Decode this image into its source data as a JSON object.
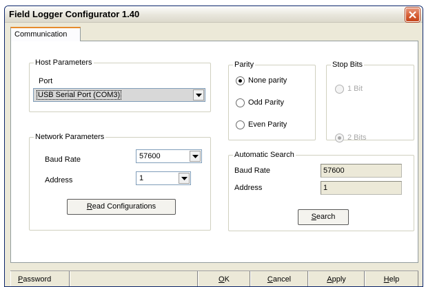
{
  "window": {
    "title": "Field Logger Configurator 1.40"
  },
  "tabs": [
    {
      "label": "Communication",
      "active": true
    }
  ],
  "host_parameters": {
    "title": "Host Parameters",
    "port_label": "Port",
    "port_value": "USB Serial Port (COM3)"
  },
  "network_parameters": {
    "title": "Network Parameters",
    "baud_rate_label": "Baud Rate",
    "baud_rate_value": "57600",
    "address_label": "Address",
    "address_value": "1",
    "read_button": {
      "prefix": "",
      "mnemonic": "R",
      "rest": "ead Configurations"
    }
  },
  "parity": {
    "title": "Parity",
    "options": [
      {
        "label": "None parity",
        "checked": true
      },
      {
        "label": "Odd Parity",
        "checked": false
      },
      {
        "label": "Even Parity",
        "checked": false
      }
    ]
  },
  "stop_bits": {
    "title": "Stop Bits",
    "options": [
      {
        "label": "1 Bit",
        "checked": false,
        "disabled": true
      },
      {
        "label": "2 Bits",
        "checked": true,
        "disabled": true
      }
    ]
  },
  "automatic_search": {
    "title": "Automatic Search",
    "baud_rate_label": "Baud Rate",
    "baud_rate_value": "57600",
    "address_label": "Address",
    "address_value": "1",
    "search_button": {
      "prefix": "",
      "mnemonic": "S",
      "rest": "earch"
    }
  },
  "statusbar": {
    "password": {
      "prefix": "",
      "mnemonic": "P",
      "rest": "assword"
    },
    "ok": {
      "prefix": "",
      "mnemonic": "O",
      "rest": "K"
    },
    "cancel": {
      "prefix": "",
      "mnemonic": "C",
      "rest": "ancel"
    },
    "apply": {
      "prefix": "",
      "mnemonic": "A",
      "rest": "pply"
    },
    "help": {
      "prefix": "",
      "mnemonic": "H",
      "rest": "elp"
    }
  },
  "colors": {
    "title_bar": "#e8e6dc",
    "close_button": "#d55a2f",
    "tab_highlight": "#e68b2c",
    "panel": "#ffffff",
    "dialog": "#ece9d8"
  },
  "icons": {
    "close": "close-icon",
    "dropdown": "chevron-down-icon"
  }
}
